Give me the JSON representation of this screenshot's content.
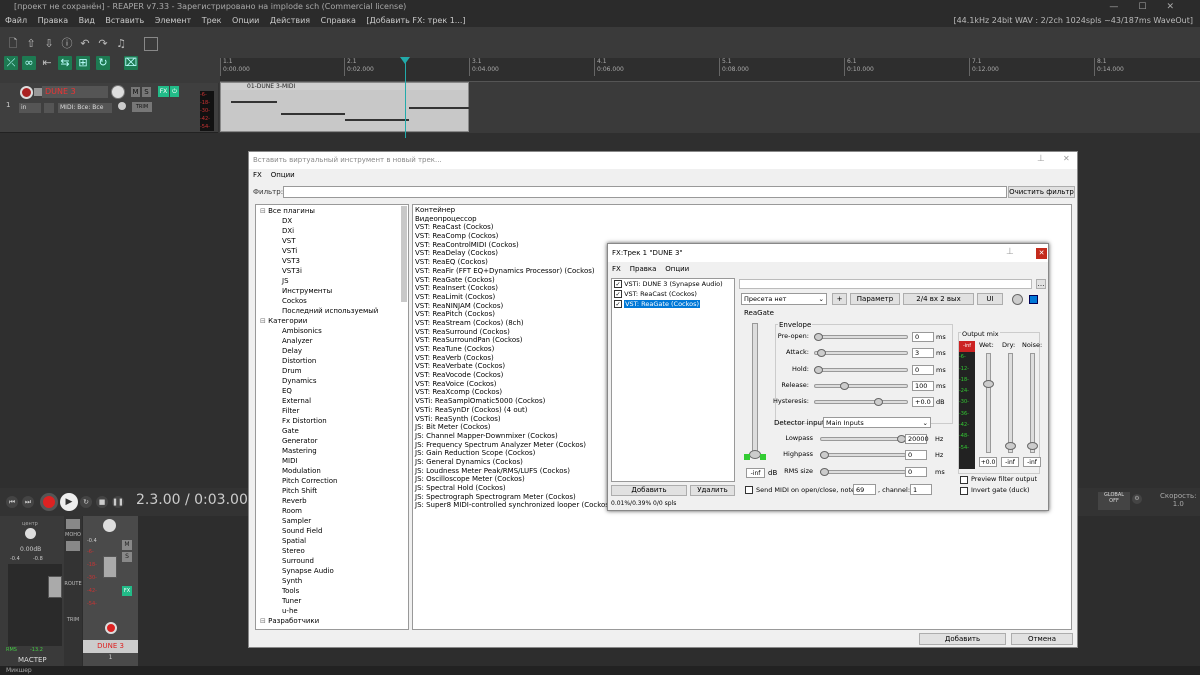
{
  "window_title": "[проект не сохранён] - REAPER v7.33 - Зарегистрировано на implode sch (Commercial license)",
  "menu": [
    "Файл",
    "Правка",
    "Вид",
    "Вставить",
    "Элемент",
    "Трек",
    "Опции",
    "Действия",
    "Справка",
    "[Добавить FX: трек 1...]"
  ],
  "audio_status": "[44.1kHz 24bit WAV : 2/2ch 1024spls ~43/187ms WaveOut]",
  "ruler": [
    {
      "bar": "1.1",
      "time": "0:00.000"
    },
    {
      "bar": "2.1",
      "time": "0:02.000"
    },
    {
      "bar": "3.1",
      "time": "0:04.000"
    },
    {
      "bar": "4.1",
      "time": "0:06.000"
    },
    {
      "bar": "5.1",
      "time": "0:08.000"
    },
    {
      "bar": "6.1",
      "time": "0:10.000"
    },
    {
      "bar": "7.1",
      "time": "0:12.000"
    },
    {
      "bar": "8.1",
      "time": "0:14.000"
    }
  ],
  "track": {
    "number": "1",
    "name": "DUNE 3",
    "input": "in",
    "midi_input": "MIDI: Все: Все ка",
    "trim": "TRIM",
    "m": "M",
    "s": "S",
    "fx": "FX",
    "item_name": "01-DUNE 3-MIDI",
    "meter_scale": [
      "-6-",
      "-18-",
      "-30-",
      "-42-",
      "-54-"
    ]
  },
  "transport": {
    "time": "2.3.00 / 0:03.000",
    "global": "GLOBAL",
    "off": "OFF",
    "rate_label": "Скорость:",
    "rate_value": "1.0"
  },
  "mixer": {
    "master_label": "МАСТЕР",
    "master_db": "0.00dB",
    "master_l": "-0.4",
    "master_r": "-0.8",
    "center": "центр",
    "rms_label": "RMS",
    "rms_value": "-13.2",
    "mono": "МОНО",
    "route": "ROUTE",
    "trim": "TRIM",
    "track_name": "DUNE 3",
    "track_num": "1",
    "track_vol": "-0.4",
    "scale": [
      "-6-",
      "-18-",
      "-30-",
      "-42-",
      "-54-"
    ],
    "master_scale": [
      "-0.4",
      "-0.8",
      "12",
      "6",
      "0",
      "-6",
      "-12",
      "-18",
      "-24",
      "-30",
      "-36",
      "-42",
      "-48",
      "-54"
    ]
  },
  "statusbar": "Микшер",
  "browser": {
    "title": "Вставить виртуальный инструмент в новый трек...",
    "menu": [
      "FX",
      "Опции"
    ],
    "filter_label": "Фильтр:",
    "clear_filter": "Очистить фильтр",
    "tree": [
      {
        "t": "Все плагины",
        "lvl": 0,
        "exp": true
      },
      {
        "t": "DX",
        "lvl": 1
      },
      {
        "t": "DXi",
        "lvl": 1
      },
      {
        "t": "VST",
        "lvl": 1
      },
      {
        "t": "VSTi",
        "lvl": 1
      },
      {
        "t": "VST3",
        "lvl": 1
      },
      {
        "t": "VST3i",
        "lvl": 1
      },
      {
        "t": "JS",
        "lvl": 1
      },
      {
        "t": "Инструменты",
        "lvl": 1
      },
      {
        "t": "Cockos",
        "lvl": 1
      },
      {
        "t": "Последний используемый",
        "lvl": 1
      },
      {
        "t": "Категории",
        "lvl": 0,
        "exp": true
      },
      {
        "t": "Ambisonics",
        "lvl": 1
      },
      {
        "t": "Analyzer",
        "lvl": 1
      },
      {
        "t": "Delay",
        "lvl": 1
      },
      {
        "t": "Distortion",
        "lvl": 1
      },
      {
        "t": "Drum",
        "lvl": 1
      },
      {
        "t": "Dynamics",
        "lvl": 1
      },
      {
        "t": "EQ",
        "lvl": 1
      },
      {
        "t": "External",
        "lvl": 1
      },
      {
        "t": "Filter",
        "lvl": 1
      },
      {
        "t": "Fx Distortion",
        "lvl": 1
      },
      {
        "t": "Gate",
        "lvl": 1
      },
      {
        "t": "Generator",
        "lvl": 1
      },
      {
        "t": "Mastering",
        "lvl": 1
      },
      {
        "t": "MIDI",
        "lvl": 1
      },
      {
        "t": "Modulation",
        "lvl": 1
      },
      {
        "t": "Pitch Correction",
        "lvl": 1
      },
      {
        "t": "Pitch Shift",
        "lvl": 1
      },
      {
        "t": "Reverb",
        "lvl": 1
      },
      {
        "t": "Room",
        "lvl": 1
      },
      {
        "t": "Sampler",
        "lvl": 1
      },
      {
        "t": "Sound Field",
        "lvl": 1
      },
      {
        "t": "Spatial",
        "lvl": 1
      },
      {
        "t": "Stereo",
        "lvl": 1
      },
      {
        "t": "Surround",
        "lvl": 1
      },
      {
        "t": "Synapse Audio",
        "lvl": 1
      },
      {
        "t": "Synth",
        "lvl": 1
      },
      {
        "t": "Tools",
        "lvl": 1
      },
      {
        "t": "Tuner",
        "lvl": 1
      },
      {
        "t": "u-he",
        "lvl": 1
      },
      {
        "t": "Разработчики",
        "lvl": 0,
        "exp": true
      }
    ],
    "plugins": [
      "Контейнер",
      "Видеопроцессор",
      "VST: ReaCast (Cockos)",
      "VST: ReaComp (Cockos)",
      "VST: ReaControlMIDI (Cockos)",
      "VST: ReaDelay (Cockos)",
      "VST: ReaEQ (Cockos)",
      "VST: ReaFir (FFT EQ+Dynamics Processor) (Cockos)",
      "VST: ReaGate (Cockos)",
      "VST: ReaInsert (Cockos)",
      "VST: ReaLimit (Cockos)",
      "VST: ReaNINJAM (Cockos)",
      "VST: ReaPitch (Cockos)",
      "VST: ReaStream (Cockos) (8ch)",
      "VST: ReaSurround (Cockos)",
      "VST: ReaSurroundPan (Cockos)",
      "VST: ReaTune (Cockos)",
      "VST: ReaVerb (Cockos)",
      "VST: ReaVerbate (Cockos)",
      "VST: ReaVocode (Cockos)",
      "VST: ReaVoice (Cockos)",
      "VST: ReaXcomp (Cockos)",
      "VSTi: ReaSamplOmatic5000 (Cockos)",
      "VSTi: ReaSynDr (Cockos) (4 out)",
      "VSTi: ReaSynth (Cockos)",
      "JS: Bit Meter (Cockos)",
      "JS: Channel Mapper-Downmixer (Cockos)",
      "JS: Frequency Spectrum Analyzer Meter (Cockos)",
      "JS: Gain Reduction Scope (Cockos)",
      "JS: General Dynamics (Cockos)",
      "JS: Loudness Meter Peak/RMS/LUFS (Cockos)",
      "JS: Oscilloscope Meter (Cockos)",
      "JS: Spectral Hold (Cockos)",
      "JS: Spectrograph Spectrogram Meter (Cockos)",
      "JS: Super8 MIDI-controlled synchronized looper (Cockos)"
    ],
    "add": "Добавить",
    "cancel": "Отмена"
  },
  "fxchain": {
    "title": "FX:Трек 1 \"DUNE 3\"",
    "menu": [
      "FX",
      "Правка",
      "Опции"
    ],
    "chain": [
      "VSTi: DUNE 3 (Synapse Audio)",
      "VST: ReaCast (Cockos)",
      "VST: ReaGate (Cockos)"
    ],
    "add": "Добавить",
    "remove": "Удалить",
    "cpu": "0.01%/0.39% 0/0 spls",
    "preset": "Пресета нет",
    "plus": "+",
    "param": "Параметр",
    "io": "2/4 вх 2 вых",
    "ui": "UI",
    "plugin_name": "ReaGate",
    "envelope": "Envelope",
    "sliders": [
      {
        "label": "Pre-open:",
        "value": "0",
        "unit": "ms",
        "pos": 0.0
      },
      {
        "label": "Attack:",
        "value": "3",
        "unit": "ms",
        "pos": 0.03
      },
      {
        "label": "Hold:",
        "value": "0",
        "unit": "ms",
        "pos": 0.0
      },
      {
        "label": "Release:",
        "value": "100",
        "unit": "ms",
        "pos": 0.3
      },
      {
        "label": "Hysteresis:",
        "value": "+0.0",
        "unit": "dB",
        "pos": 0.7
      }
    ],
    "detector_label": "Detector input:",
    "detector_value": "Main Inputs",
    "lowpass": {
      "label": "Lowpass",
      "value": "20000",
      "unit": "Hz",
      "pos": 1.0
    },
    "highpass": {
      "label": "Highpass",
      "value": "0",
      "unit": "Hz",
      "pos": 0.0
    },
    "rms": {
      "label": "RMS size",
      "value": "0",
      "unit": "ms",
      "pos": 0.0
    },
    "thresh_value": "-inf",
    "thresh_unit": "dB",
    "send_midi": "Send MIDI on open/close, note:",
    "note": "69",
    "channel_label": ", channel:",
    "channel": "1",
    "output_mix": "Output mix",
    "wet": "Wet:",
    "dry": "Dry:",
    "noise": "Noise:",
    "wet_val": "+0.0",
    "dry_val": "-inf",
    "noise_val": "-inf",
    "out_scale": [
      "-inf",
      "-6-",
      "-12-",
      "-18-",
      "-24-",
      "-30-",
      "-36-",
      "-42-",
      "-48-",
      "-54-"
    ],
    "preview": "Preview filter output",
    "invert": "Invert gate (duck)"
  }
}
